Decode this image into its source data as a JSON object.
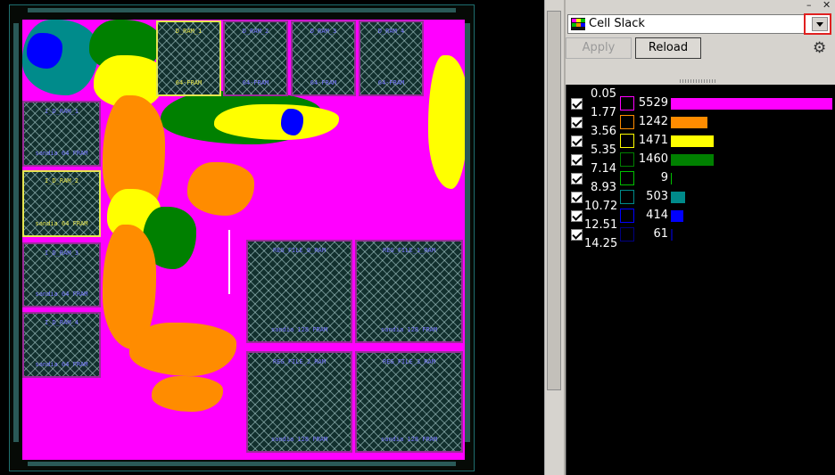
{
  "layout": {
    "macros": [
      {
        "id": "m1",
        "top": "D_RAM_1",
        "bottom": "64-FRAM",
        "selected": true
      },
      {
        "id": "m2",
        "top": "D_RAM_2",
        "bottom": "64-FRAM",
        "selected": false
      },
      {
        "id": "m3",
        "top": "D_RAM_3",
        "bottom": "64-FRAM",
        "selected": false
      },
      {
        "id": "m4",
        "top": "D_RAM_4",
        "bottom": "64-FRAM",
        "selected": false
      },
      {
        "id": "m5",
        "top": "I_D_RAM_1",
        "bottom": "sandia 64 FRAM",
        "selected": false
      },
      {
        "id": "m6",
        "top": "I_D_RAM_2",
        "bottom": "sandia 64 FRAM",
        "selected": true
      },
      {
        "id": "m7",
        "top": "I_D_RAM_3",
        "bottom": "sandia 64 FRAM",
        "selected": false
      },
      {
        "id": "m8",
        "top": "I_D_RAM_4",
        "bottom": "sandia 64 FRAM",
        "selected": false
      },
      {
        "id": "m9",
        "top": "REG_FILE_0_RAM",
        "bottom": "sandia 128 FRAM",
        "selected": false
      },
      {
        "id": "m10",
        "top": "REG_FILE_1_RAM",
        "bottom": "sandia 128 FRAM",
        "selected": false
      },
      {
        "id": "m11",
        "top": "REG_FILE_2_RAM",
        "bottom": "sandia 128 FRAM",
        "selected": false
      },
      {
        "id": "m12",
        "top": "REG_FILE_3_RAM",
        "bottom": "sandia 128 FRAM",
        "selected": false
      }
    ]
  },
  "panel": {
    "heatmap_selector": {
      "value": "Cell Slack"
    },
    "apply_label": "Apply",
    "reload_label": "Reload",
    "gear_icon": "gear-icon",
    "thresholds": [
      "0.05",
      "1.77",
      "3.56",
      "5.35",
      "7.14",
      "8.93",
      "10.72",
      "12.51",
      "14.25"
    ],
    "bins": [
      {
        "color": "#ff00ff",
        "count": "5529",
        "value": 5529,
        "checked": true
      },
      {
        "color": "#ff8c00",
        "count": "1242",
        "value": 1242,
        "checked": true
      },
      {
        "color": "#ffff00",
        "count": "1471",
        "value": 1471,
        "checked": true
      },
      {
        "color": "#008000",
        "count": "1460",
        "value": 1460,
        "checked": true
      },
      {
        "color": "#00c000",
        "count": "9",
        "value": 9,
        "checked": true
      },
      {
        "color": "#008b8b",
        "count": "503",
        "value": 503,
        "checked": true
      },
      {
        "color": "#0000ff",
        "count": "414",
        "value": 414,
        "checked": true
      },
      {
        "color": "#000080",
        "count": "61",
        "value": 61,
        "checked": true
      }
    ],
    "max_bin_value": 5529
  }
}
